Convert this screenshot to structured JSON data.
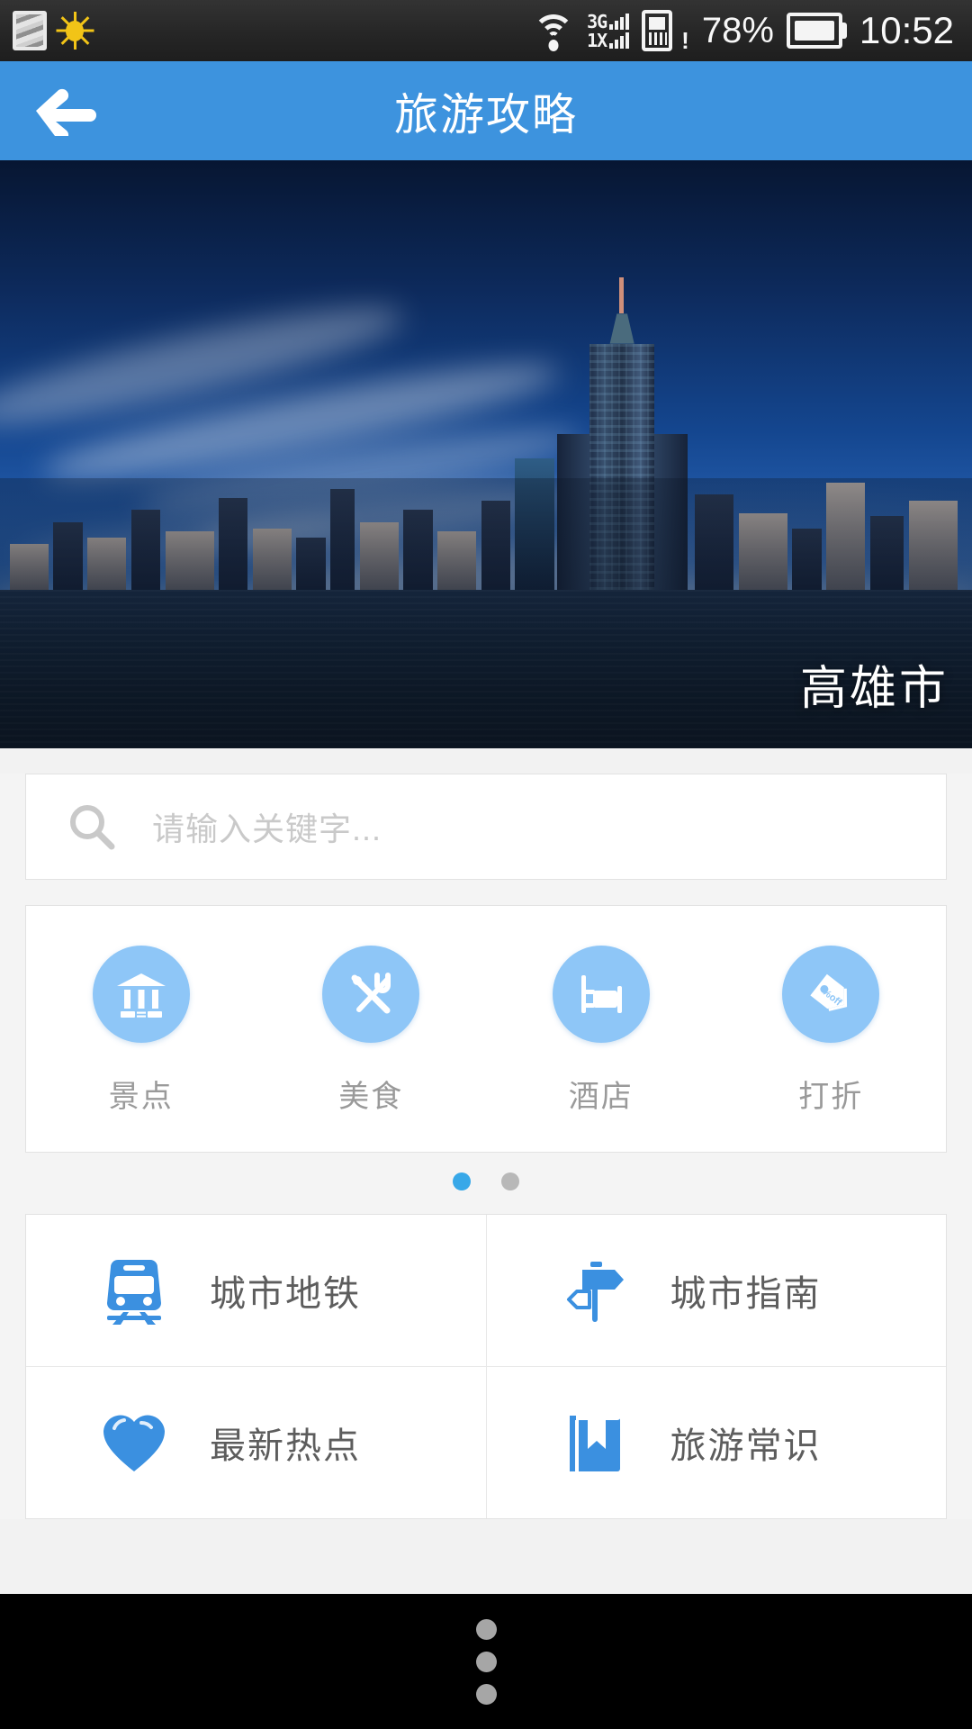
{
  "status_bar": {
    "icons_left": [
      "gallery-icon",
      "brightness-sun-icon"
    ],
    "wifi": "wifi-icon",
    "network_3g": "3G",
    "network_1x": "1X",
    "sim": "sim-card-alert-icon",
    "sim_alert": "!",
    "battery_percent": "78%",
    "battery": "battery-icon",
    "clock": "10:52"
  },
  "header": {
    "back": "back-arrow-icon",
    "title": "旅游攻略"
  },
  "hero": {
    "city_name": "高雄市",
    "image": "kaohsiung-skyline-photo"
  },
  "search": {
    "icon": "search-icon",
    "placeholder": "请输入关键字..."
  },
  "quick_actions": {
    "items": [
      {
        "label": "景点",
        "icon": "museum-icon"
      },
      {
        "label": "美食",
        "icon": "fork-knife-icon"
      },
      {
        "label": "酒店",
        "icon": "bed-icon"
      },
      {
        "label": "打折",
        "icon": "discount-tag-icon"
      }
    ],
    "pagination": {
      "total": 2,
      "active": 1
    }
  },
  "menu_grid": {
    "rows": [
      [
        {
          "label": "城市地铁",
          "icon": "subway-train-icon"
        },
        {
          "label": "城市指南",
          "icon": "signpost-icon"
        }
      ],
      [
        {
          "label": "最新热点",
          "icon": "heart-icon"
        },
        {
          "label": "旅游常识",
          "icon": "bookmark-book-icon"
        }
      ]
    ]
  },
  "nav_bar": {
    "menu": "overflow-menu-icon"
  },
  "colors": {
    "header_blue": "#3d93de",
    "accent_blue": "#3b90e0",
    "circle_blue": "#8ec6f7",
    "dot_active": "#38a8e8",
    "dot_inactive": "#b8b8b8",
    "page_bg": "#f4f4f4"
  }
}
